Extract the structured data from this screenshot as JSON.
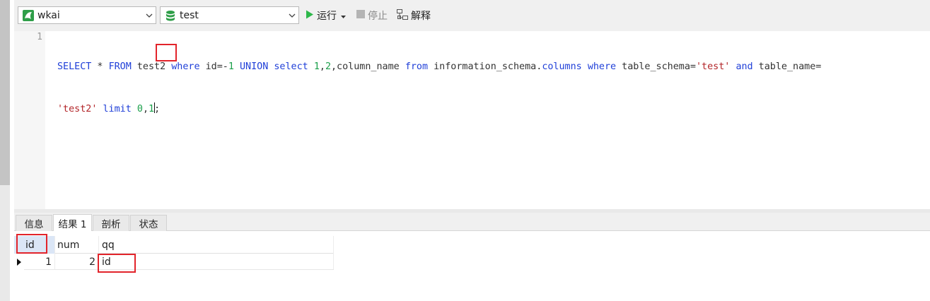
{
  "toolbar": {
    "connection": "wkai",
    "database": "test",
    "run_label": "运行",
    "stop_label": "停止",
    "explain_label": "解释",
    "colors": {
      "run": "#2db84a",
      "connection_icon": "#2e9e48",
      "database_icon": "#2e9e48"
    }
  },
  "editor": {
    "line_number": "1",
    "line1": [
      {
        "t": "SELECT",
        "c": "kw"
      },
      {
        "t": " * ",
        "c": "pl"
      },
      {
        "t": "FROM",
        "c": "kw"
      },
      {
        "t": " test2 ",
        "c": "pl"
      },
      {
        "t": "where",
        "c": "kw"
      },
      {
        "t": " id=-",
        "c": "pl"
      },
      {
        "t": "1",
        "c": "num"
      },
      {
        "t": " ",
        "c": "pl"
      },
      {
        "t": "UNION",
        "c": "kw"
      },
      {
        "t": " ",
        "c": "pl"
      },
      {
        "t": "select",
        "c": "kw"
      },
      {
        "t": " ",
        "c": "pl"
      },
      {
        "t": "1",
        "c": "num"
      },
      {
        "t": ",",
        "c": "pl"
      },
      {
        "t": "2",
        "c": "num"
      },
      {
        "t": ",column_name ",
        "c": "pl"
      },
      {
        "t": "from",
        "c": "kw"
      },
      {
        "t": " information_schema.",
        "c": "pl"
      },
      {
        "t": "columns",
        "c": "kw"
      },
      {
        "t": " ",
        "c": "pl"
      },
      {
        "t": "where",
        "c": "kw"
      },
      {
        "t": " table_schema=",
        "c": "pl"
      },
      {
        "t": "'test'",
        "c": "str"
      },
      {
        "t": " ",
        "c": "pl"
      },
      {
        "t": "and",
        "c": "kw"
      },
      {
        "t": " table_name=",
        "c": "pl"
      }
    ],
    "line2": [
      {
        "t": "'test2'",
        "c": "str"
      },
      {
        "t": " ",
        "c": "pl"
      },
      {
        "t": "limit",
        "c": "kw"
      },
      {
        "t": " ",
        "c": "pl"
      },
      {
        "t": "0",
        "c": "num"
      },
      {
        "t": ",",
        "c": "pl"
      },
      {
        "t": "1",
        "c": "num"
      },
      {
        "t": "|caret|",
        "c": "caret"
      },
      {
        "t": ";",
        "c": "pl"
      }
    ]
  },
  "result_tabs": [
    "信息",
    "结果 1",
    "剖析",
    "状态"
  ],
  "result_grid": {
    "columns": [
      "id",
      "num",
      "qq"
    ],
    "rows": [
      [
        "1",
        "2",
        "id"
      ]
    ]
  },
  "highlight_color": "#e2242b"
}
